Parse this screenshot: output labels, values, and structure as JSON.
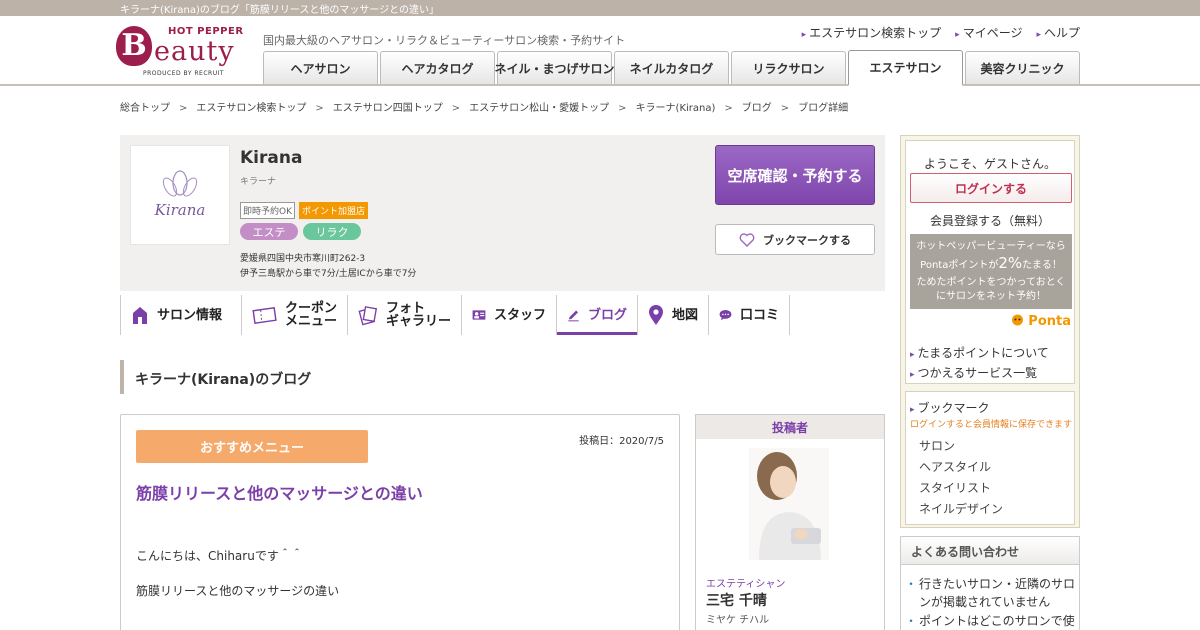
{
  "page": {
    "topbar_text": "キラーナ(Kirana)のブログ「筋膜リリースと他のマッサージとの違い」"
  },
  "header": {
    "logo": {
      "top": "HOT PEPPER",
      "big": "B",
      "rest": "eauty",
      "produced": "PRODUCED BY RECRUIT"
    },
    "tagline": "国内最大級のヘアサロン・リラク＆ビューティーサロン検索・予約サイト",
    "links": [
      "エステサロン検索トップ",
      "マイページ",
      "ヘルプ"
    ],
    "tabs": [
      "ヘアサロン",
      "ヘアカタログ",
      "ネイル・まつげサロン",
      "ネイルカタログ",
      "リラクサロン",
      "エステサロン",
      "美容クリニック"
    ]
  },
  "breadcrumb": [
    "総合トップ",
    "エステサロン検索トップ",
    "エステサロン四国トップ",
    "エステサロン松山・愛媛トップ",
    "キラーナ(Kirana)",
    "ブログ",
    "ブログ詳細"
  ],
  "breadcrumb_sep": ">",
  "salon": {
    "logo_text": "Kirana",
    "name": "Kirana",
    "kana": "キラーナ",
    "badges": [
      "即時予約OK",
      "ポイント加盟店"
    ],
    "categories": [
      "エステ",
      "リラク"
    ],
    "address": "愛媛県四国中央市寒川町262-3",
    "access": "伊予三島駅から車で7分/土居ICから車で7分",
    "reserve_label": "空席確認・予約する",
    "bookmark_label": "ブックマークする"
  },
  "subnav": [
    {
      "l1": "サロン情報",
      "l2": ""
    },
    {
      "l1": "クーポン",
      "l2": "メニュー"
    },
    {
      "l1": "フォト",
      "l2": "ギャラリー"
    },
    {
      "l1": "スタッフ",
      "l2": ""
    },
    {
      "l1": "ブログ",
      "l2": ""
    },
    {
      "l1": "地図",
      "l2": ""
    },
    {
      "l1": "口コミ",
      "l2": ""
    }
  ],
  "blog_heading": "キラーナ(Kirana)のブログ",
  "article": {
    "category_label": "おすすめメニュー",
    "date": "投稿日：2020/7/5",
    "title": "筋膜リリースと他のマッサージとの違い",
    "body": [
      "こんにちは、Chiharuです＾＾",
      "筋膜リリースと他のマッサージの違い"
    ]
  },
  "poster": {
    "heading": "投稿者",
    "role": "エステティシャン",
    "name": "三宅 千晴",
    "kana": "ミヤケ チハル"
  },
  "sidebar": {
    "welcome": "ようこそ、ゲストさん。",
    "login": "ログインする",
    "register": "会員登録する（無料）",
    "ponta_l1": "ホットペッパービューティーなら",
    "ponta_l2a": "Pontaポイントが",
    "ponta_l2b": "2%",
    "ponta_l2c": "たまる！",
    "ponta_l3": "ためたポイントをつかっておとく",
    "ponta_l4": "にサロンをネット予約！",
    "ponta_logo": "Ponta",
    "links": [
      "たまるポイントについて",
      "つかえるサービス一覧"
    ],
    "bookmark_title": "ブックマーク",
    "bookmark_note": "ログインすると会員情報に保存できます",
    "bookmark_items": [
      "サロン",
      "ヘアスタイル",
      "スタイリスト",
      "ネイルデザイン"
    ],
    "faq_title": "よくある問い合わせ",
    "faq": [
      "行きたいサロン・近隣のサロンが掲載されていません",
      "ポイントはどこのサロンで使"
    ]
  },
  "colors": {
    "brand": "#9c1e4c",
    "accent": "#7b3fa8",
    "reserve": "#8a52b8",
    "recommend": "#f5a96b",
    "ponta": "#f39800"
  }
}
